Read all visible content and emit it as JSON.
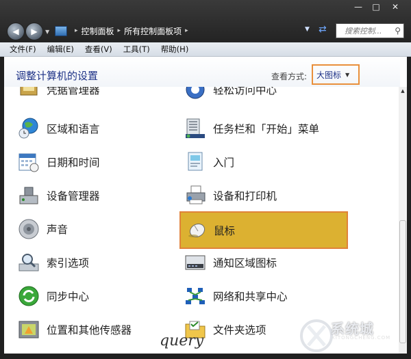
{
  "window": {
    "caption_buttons": [
      "minimize-icon",
      "maximize-icon",
      "close-icon"
    ]
  },
  "address_bar": {
    "crumbs": [
      "控制面板",
      "所有控制面板项"
    ],
    "search_placeholder": "搜索控制..."
  },
  "menu": [
    "文件(F)",
    "编辑(E)",
    "查看(V)",
    "工具(T)",
    "帮助(H)"
  ],
  "header": {
    "title": "调整计算机的设置",
    "view_by_label": "查看方式:",
    "view_by_value": "大图标"
  },
  "items_left": [
    {
      "label": "凭据管理器",
      "icon": "credential-icon"
    },
    {
      "label": "区域和语言",
      "icon": "globe-clock-icon"
    },
    {
      "label": "日期和时间",
      "icon": "calendar-clock-icon"
    },
    {
      "label": "设备管理器",
      "icon": "device-manager-icon"
    },
    {
      "label": "声音",
      "icon": "speaker-icon"
    },
    {
      "label": "索引选项",
      "icon": "magnifier-icon"
    },
    {
      "label": "同步中心",
      "icon": "sync-icon"
    },
    {
      "label": "位置和其他传感器",
      "icon": "location-sensor-icon"
    }
  ],
  "items_right": [
    {
      "label": "轻松访问中心",
      "icon": "ease-of-access-icon"
    },
    {
      "label": "任务栏和「开始」菜单",
      "icon": "taskbar-icon"
    },
    {
      "label": "入门",
      "icon": "getting-started-icon"
    },
    {
      "label": "设备和打印机",
      "icon": "printer-icon"
    },
    {
      "label": "鼠标",
      "icon": "mouse-icon",
      "highlighted": true
    },
    {
      "label": "通知区域图标",
      "icon": "notification-area-icon"
    },
    {
      "label": "网络和共享中心",
      "icon": "network-icon"
    },
    {
      "label": "文件夹选项",
      "icon": "folder-icon"
    }
  ],
  "watermark": {
    "text": "系统城",
    "url": "XITONGCHENG.COM"
  },
  "signature": "query"
}
